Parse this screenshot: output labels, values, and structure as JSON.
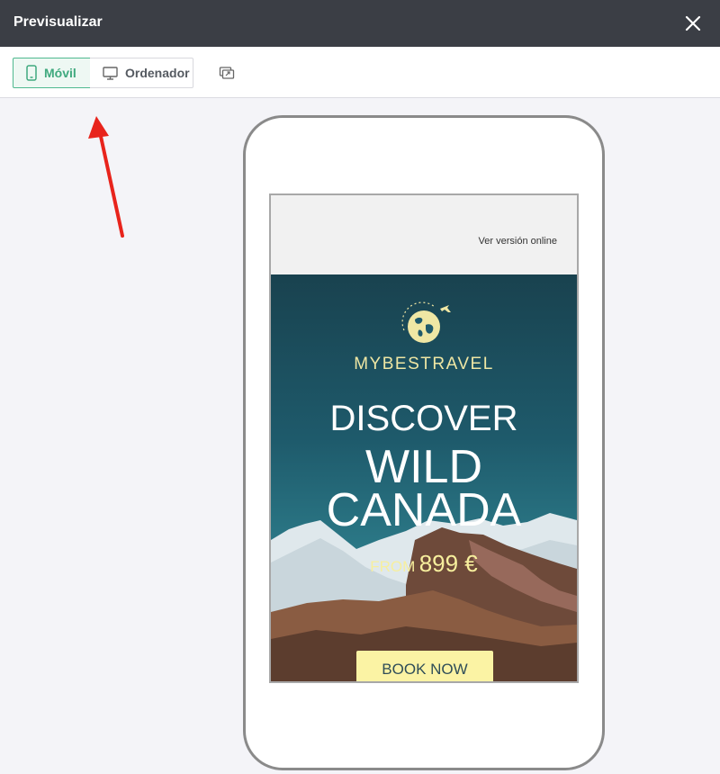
{
  "header": {
    "title": "Previsualizar"
  },
  "toolbar": {
    "mobile_label": "Móvil",
    "desktop_label": "Ordenador"
  },
  "email": {
    "online_link": "Ver versión online",
    "brand": "MYBESTRAVEL",
    "headline": "DISCOVER",
    "subheadline_1": "WILD",
    "subheadline_2": "CANADA",
    "price_prefix": "FROM",
    "price_amount": "899 €",
    "cta_label": "BOOK NOW"
  },
  "colors": {
    "accent": "#3fa97e",
    "header_bg": "#3b3e45",
    "annotation_arrow": "#e8241c",
    "cta_bg": "#fbf3a4",
    "brand_text": "#efe7a4"
  },
  "icons": {
    "close": "close-icon",
    "mobile": "mobile-phone-icon",
    "desktop": "desktop-monitor-icon",
    "extra": "share-preview-icon",
    "logo": "globe-plane-logo"
  }
}
